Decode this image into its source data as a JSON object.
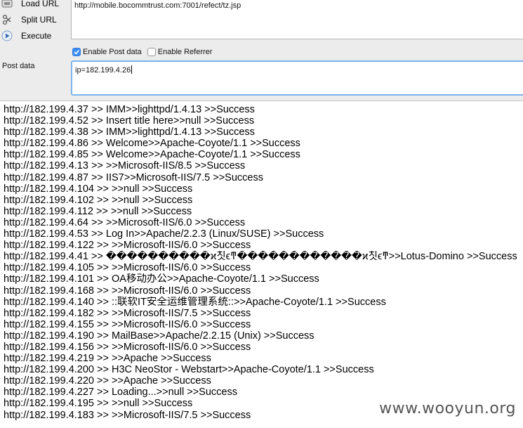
{
  "toolbar": {
    "load_url": "Load URL",
    "split_url": "Split URL",
    "execute": "Execute"
  },
  "url_value": "http://mobile.bocommtrust.com:7001/refect/tz.jsp",
  "options": {
    "enable_post": "Enable Post data",
    "enable_post_checked": true,
    "enable_referrer": "Enable Referrer",
    "enable_referrer_checked": false
  },
  "post": {
    "label": "Post data",
    "value": "ip=182.199.4.26"
  },
  "results": [
    "http://182.199.4.37 >> IMM>>lighttpd/1.4.13 >>Success",
    "http://182.199.4.52 >> Insert title here>>null >>Success",
    "http://182.199.4.38 >> IMM>>lighttpd/1.4.13 >>Success",
    "http://182.199.4.86 >> Welcome>>Apache-Coyote/1.1 >>Success",
    "http://182.199.4.85 >> Welcome>>Apache-Coyote/1.1 >>Success",
    "http://182.199.4.13 >> >>Microsoft-IIS/8.5 >>Success",
    "http://182.199.4.87 >> IIS7>>Microsoft-IIS/7.5 >>Success",
    "http://182.199.4.104 >> >>null >>Success",
    "http://182.199.4.102 >> >>null >>Success",
    "http://182.199.4.112 >> >>null >>Success",
    "http://182.199.4.64 >> >>Microsoft-IIS/6.0 >>Success",
    "http://182.199.4.53 >> Log In>>Apache/2.2.3 (Linux/SUSE) >>Success",
    "http://182.199.4.122 >> >>Microsoft-IIS/6.0 >>Success",
    "http://182.199.4.41 >> ����������ϰ칫ϵͳ������������ϰ칫ϵͳ>>Lotus-Domino >>Success",
    "http://182.199.4.105 >> >>Microsoft-IIS/6.0 >>Success",
    "http://182.199.4.101 >> OA移动办公>>Apache-Coyote/1.1 >>Success",
    "http://182.199.4.168 >> >>Microsoft-IIS/6.0 >>Success",
    "http://182.199.4.140 >> ::联软IT安全运维管理系统::>>Apache-Coyote/1.1 >>Success",
    "http://182.199.4.182 >> >>Microsoft-IIS/7.5 >>Success",
    "http://182.199.4.155 >> >>Microsoft-IIS/6.0 >>Success",
    "http://182.199.4.190 >> MailBase>>Apache/2.2.15 (Unix) >>Success",
    "http://182.199.4.156 >> >>Microsoft-IIS/6.0 >>Success",
    "http://182.199.4.219 >> >>Apache >>Success",
    "http://182.199.4.200 >> H3C NeoStor - Webstart>>Apache-Coyote/1.1 >>Success",
    "http://182.199.4.220 >> >>Apache >>Success",
    "http://182.199.4.227 >> Loading...>>null >>Success",
    "http://182.199.4.195 >> >>null >>Success",
    "http://182.199.4.183 >> >>Microsoft-IIS/7.5 >>Success"
  ],
  "watermark": "www.wooyun.org",
  "colors": {
    "panel_bg": "#ececec",
    "checkbox_checked": "#3d8ef5",
    "focus_border": "#7bb4ee"
  }
}
